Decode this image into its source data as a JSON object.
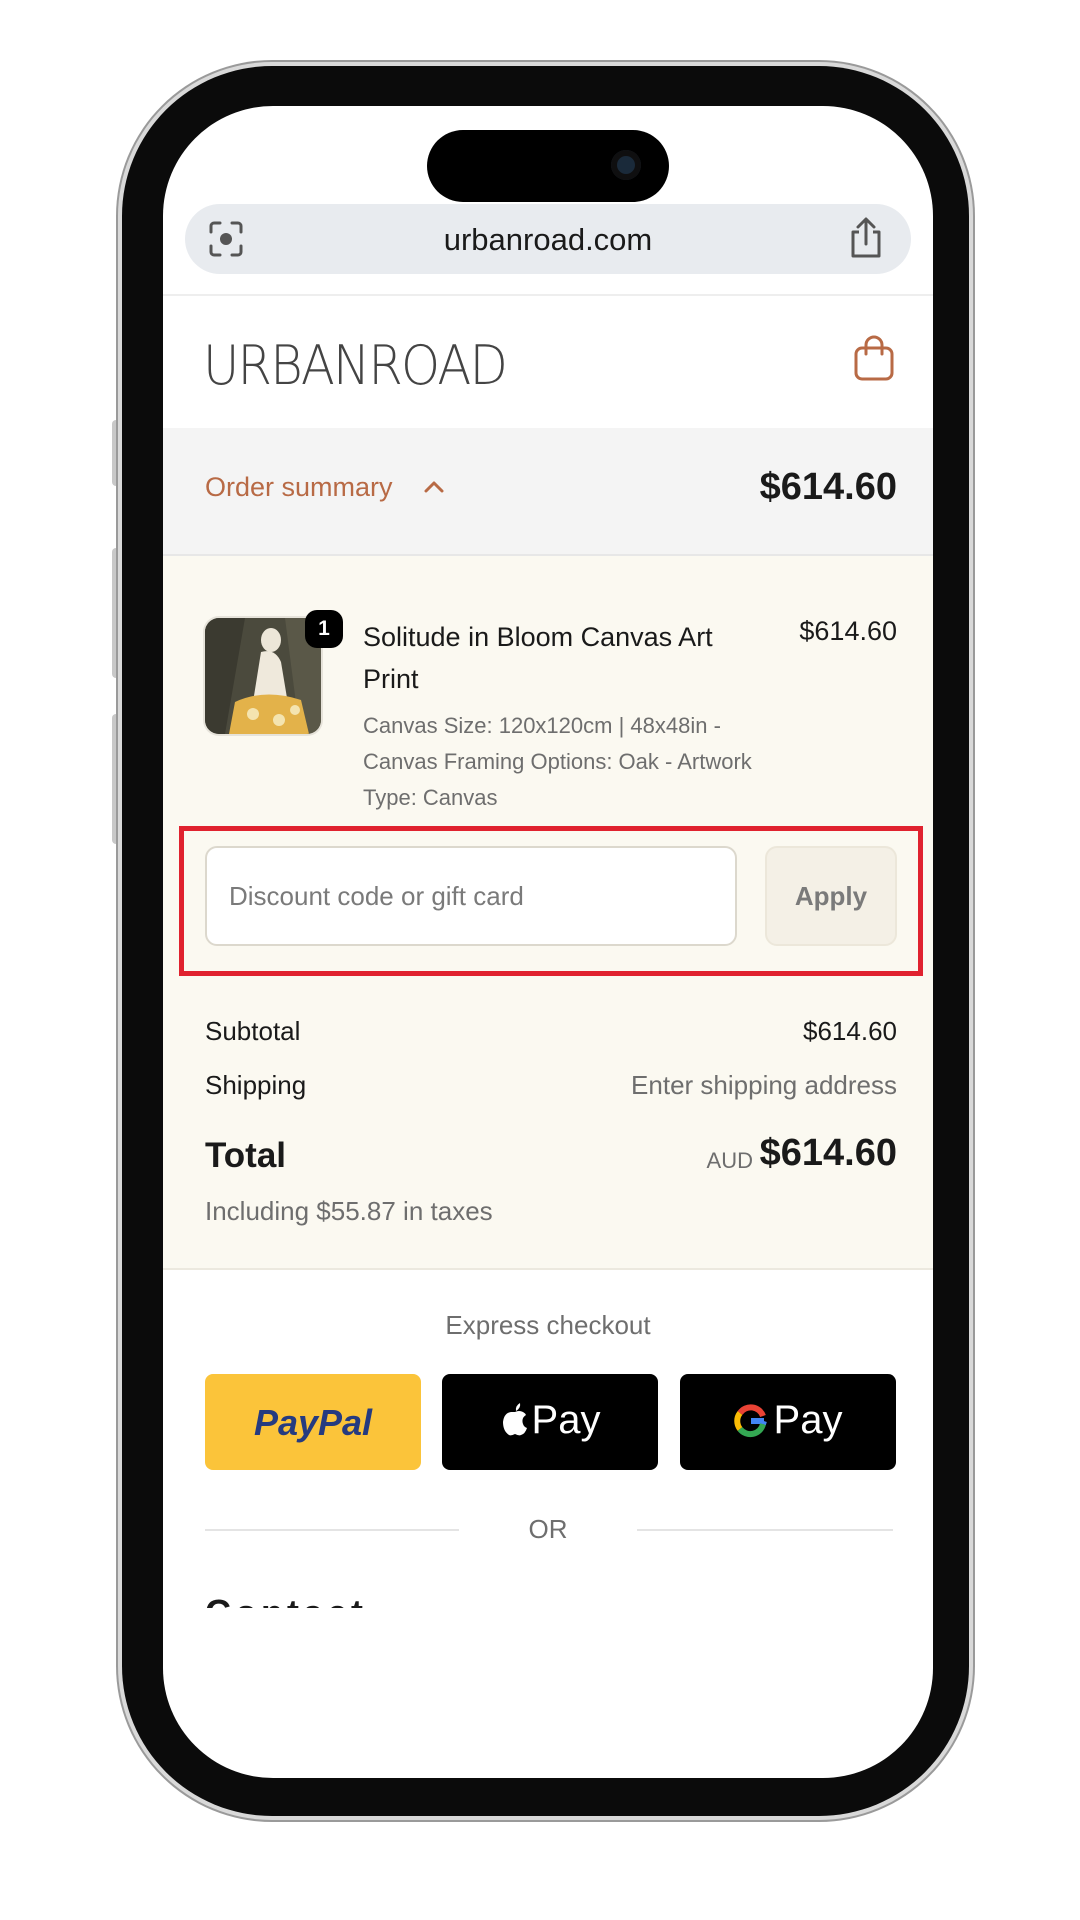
{
  "browser": {
    "url": "urbanroad.com",
    "lens_icon": "camera-lens-icon",
    "share_icon": "share-icon"
  },
  "header": {
    "logo_text": "URBANROAD",
    "cart_icon": "shopping-bag-icon"
  },
  "order_summary": {
    "label": "Order summary",
    "total": "$614.60"
  },
  "product": {
    "quantity": "1",
    "name": "Solitude in Bloom Canvas Art Print",
    "price": "$614.60",
    "variant": "Canvas Size: 120x120cm | 48x48in - Canvas Framing Options: Oak - Artwork Type: Canvas"
  },
  "discount": {
    "placeholder": "Discount code or gift card",
    "apply_label": "Apply",
    "highlight_color": "#e0222f"
  },
  "totals": {
    "subtotal_label": "Subtotal",
    "subtotal_value": "$614.60",
    "shipping_label": "Shipping",
    "shipping_value": "Enter shipping address",
    "total_label": "Total",
    "currency": "AUD",
    "total_value": "$614.60",
    "tax_note": "Including $55.87 in taxes"
  },
  "express": {
    "title": "Express checkout",
    "paypal_label": "PayPal",
    "apple_pay_label": "Pay",
    "google_pay_label": "Pay",
    "or_label": "OR"
  },
  "contact": {
    "heading_partial": "Contact"
  },
  "colors": {
    "accent": "#b86a45",
    "paypal_yellow": "#fbc43a"
  }
}
